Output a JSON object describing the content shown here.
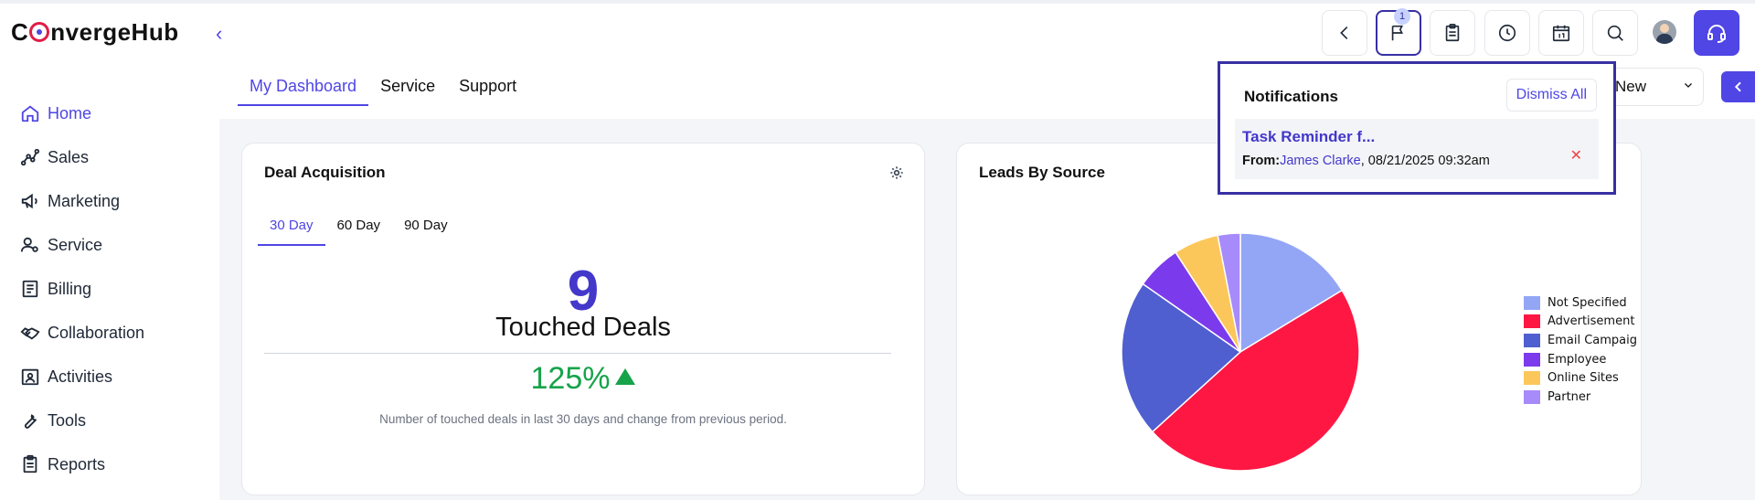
{
  "app": {
    "logo_text_pre": "C",
    "logo_text_post": "nvergeHub"
  },
  "sidebar": {
    "items": [
      {
        "label": "Home",
        "icon": "home-icon",
        "active": true
      },
      {
        "label": "Sales",
        "icon": "sales-chart-icon"
      },
      {
        "label": "Marketing",
        "icon": "megaphone-icon"
      },
      {
        "label": "Service",
        "icon": "user-gear-icon"
      },
      {
        "label": "Billing",
        "icon": "receipt-icon"
      },
      {
        "label": "Collaboration",
        "icon": "handshake-icon"
      },
      {
        "label": "Activities",
        "icon": "calendar-person-icon"
      },
      {
        "label": "Tools",
        "icon": "wrench-icon"
      },
      {
        "label": "Reports",
        "icon": "clipboard-icon"
      }
    ]
  },
  "tabs": [
    {
      "label": "My Dashboard",
      "active": true
    },
    {
      "label": "Service"
    },
    {
      "label": "Support"
    }
  ],
  "topbar": {
    "notification_count": "1",
    "new_label": "New"
  },
  "deal_card": {
    "title": "Deal Acquisition",
    "subtabs": [
      {
        "label": "30 Day",
        "active": true
      },
      {
        "label": "60 Day"
      },
      {
        "label": "90 Day"
      }
    ],
    "value": "9",
    "value_label": "Touched Deals",
    "change": "125%",
    "change_color": "#16a34a",
    "description": "Number of touched deals in last 30 days and change from previous period."
  },
  "leads_card": {
    "title": "Leads By Source"
  },
  "chart_data": {
    "type": "pie",
    "title": "Leads By Source",
    "series": [
      {
        "name": "Not Specified",
        "value": 16,
        "color": "#93a5f5"
      },
      {
        "name": "Advertisement",
        "value": 46,
        "color": "#ff1744"
      },
      {
        "name": "Email Campaig",
        "value": 21,
        "color": "#4f5fd0"
      },
      {
        "name": "Employee",
        "value": 6,
        "color": "#7c3aed"
      },
      {
        "name": "Online Sites",
        "value": 6,
        "color": "#fcc75a"
      },
      {
        "name": "Partner",
        "value": 3,
        "color": "#a78bfa"
      }
    ],
    "legend_position": "right"
  },
  "notifications": {
    "title": "Notifications",
    "dismiss_label": "Dismiss All",
    "items": [
      {
        "title": "Task Reminder f...",
        "from_label": "From:",
        "from_name": "James Clarke",
        "time": ", 08/21/2025 09:32am"
      }
    ]
  },
  "colors": {
    "accent": "#4f46e5",
    "logo_red": "#e11d48"
  }
}
